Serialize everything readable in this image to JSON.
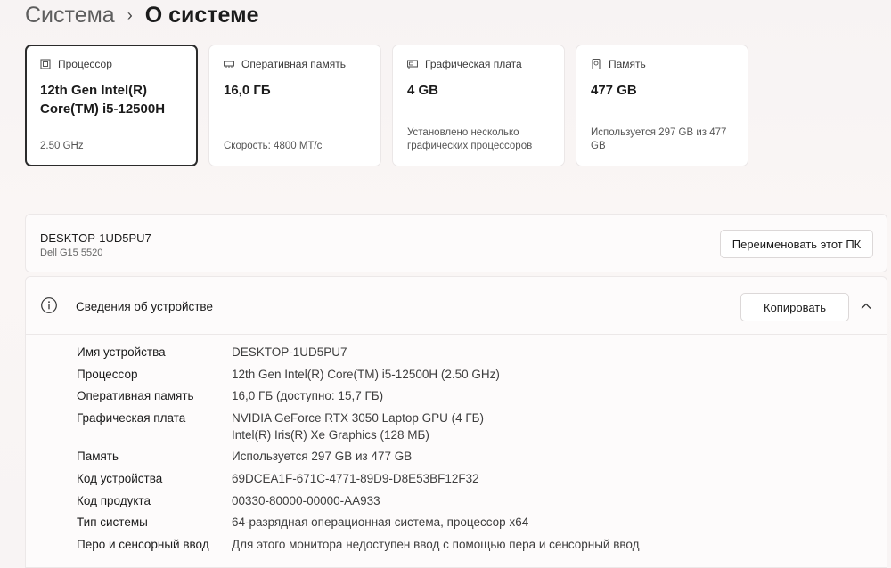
{
  "breadcrumb": {
    "parent": "Система",
    "separator": "›",
    "current": "О системе"
  },
  "cards": [
    {
      "icon": "processor-icon",
      "label": "Процессор",
      "value": "12th Gen Intel(R) Core(TM) i5-12500H",
      "sub": "2.50 GHz"
    },
    {
      "icon": "memory-icon",
      "label": "Оперативная память",
      "value": "16,0 ГБ",
      "sub": "Скорость: 4800 МТ/с"
    },
    {
      "icon": "gpu-icon",
      "label": "Графическая плата",
      "value": "4 GB",
      "sub": "Установлено несколько графических процессоров"
    },
    {
      "icon": "storage-icon",
      "label": "Память",
      "value": "477 GB",
      "sub": "Используется 297 GB из 477 GB"
    }
  ],
  "device": {
    "name": "DESKTOP-1UD5PU7",
    "model": "Dell G15 5520",
    "rename_label": "Переименовать этот ПК"
  },
  "specs": {
    "title": "Сведения об устройстве",
    "copy_label": "Копировать",
    "rows": [
      {
        "key": "Имя устройства",
        "value": "DESKTOP-1UD5PU7"
      },
      {
        "key": "Процессор",
        "value": "12th Gen Intel(R) Core(TM) i5-12500H (2.50 GHz)"
      },
      {
        "key": "Оперативная память",
        "value": "16,0 ГБ (доступно: 15,7 ГБ)"
      },
      {
        "key": "Графическая плата",
        "value": "NVIDIA GeForce RTX 3050 Laptop GPU (4 ГБ)",
        "value2": "Intel(R) Iris(R) Xe Graphics (128 МБ)"
      },
      {
        "key": "Память",
        "value": "Используется 297 GB из 477 GB"
      },
      {
        "key": "Код устройства",
        "value": "69DCEA1F-671C-4771-89D9-D8E53BF12F32"
      },
      {
        "key": "Код продукта",
        "value": "00330-80000-00000-AA933"
      },
      {
        "key": "Тип системы",
        "value": "64-разрядная операционная система, процессор x64"
      },
      {
        "key": "Перо и сенсорный ввод",
        "value": "Для этого монитора недоступен ввод с помощью пера и сенсорный ввод"
      }
    ]
  }
}
